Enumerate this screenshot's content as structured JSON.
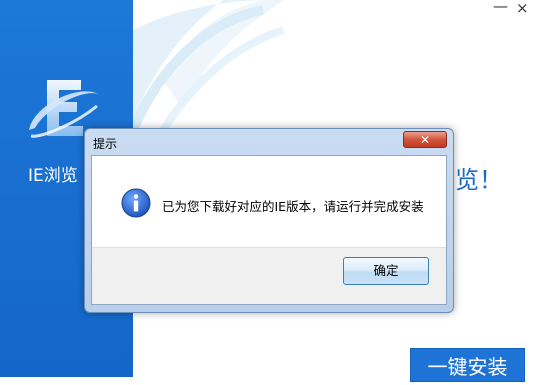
{
  "installer": {
    "product_name": "IE浏览",
    "heading_fragment": "览！",
    "install_button": "一键安装",
    "minimize_symbol": "—",
    "close_symbol": "×"
  },
  "dialog": {
    "title": "提示",
    "close_symbol": "✕",
    "message": "已为您下载好对应的IE版本，请运行并完成安装",
    "ok_button": "确定"
  },
  "colors": {
    "brand_blue": "#1466c8",
    "dialog_frame": "#b9cfe9",
    "close_red": "#c23b22"
  },
  "icons": [
    "ie-logo-icon",
    "info-icon",
    "close-icon",
    "minimize-icon"
  ]
}
